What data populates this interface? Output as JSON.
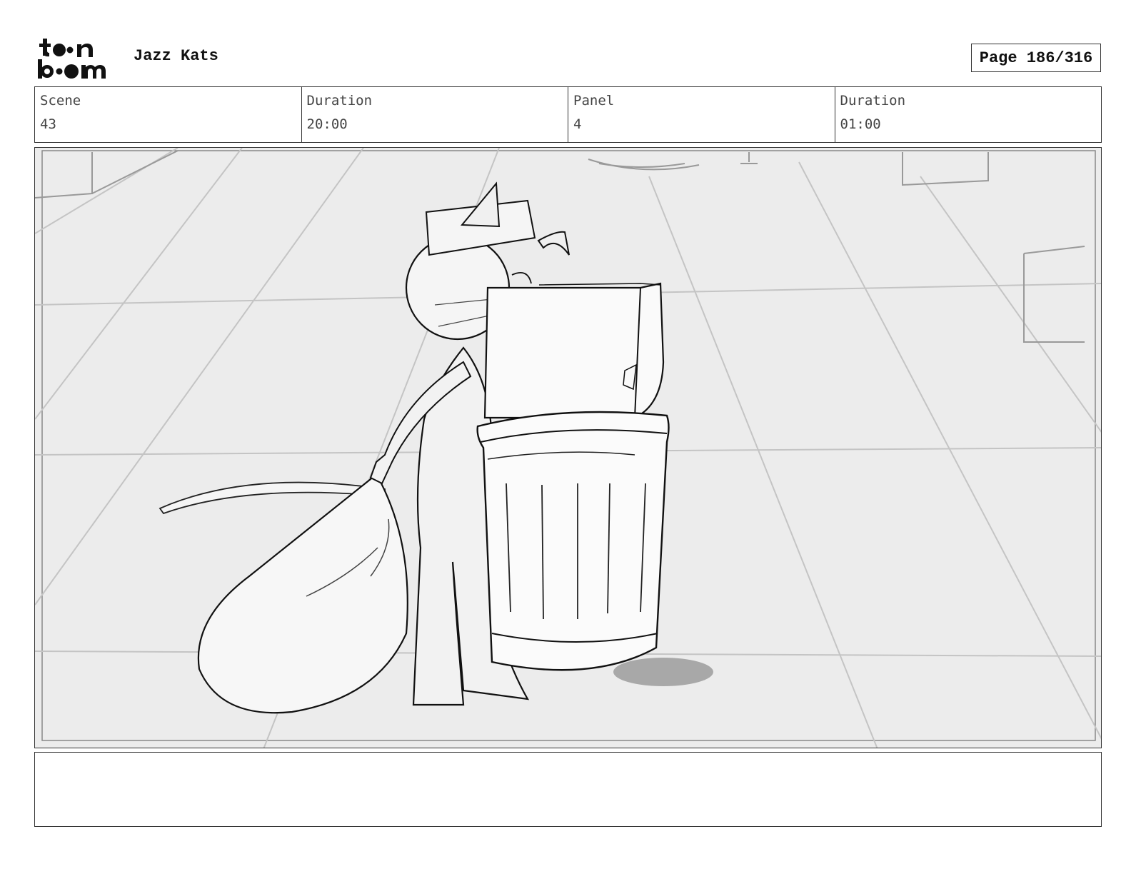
{
  "header": {
    "logo_text": "toon boom",
    "project_title": "Jazz Kats",
    "page_label": "Page 186/316"
  },
  "info": {
    "scene_label": "Scene",
    "scene_value": "43",
    "scene_duration_label": "Duration",
    "scene_duration_value": "20:00",
    "panel_label": "Panel",
    "panel_value": "4",
    "panel_duration_label": "Duration",
    "panel_duration_value": "01:00"
  },
  "notes": {
    "text": ""
  }
}
